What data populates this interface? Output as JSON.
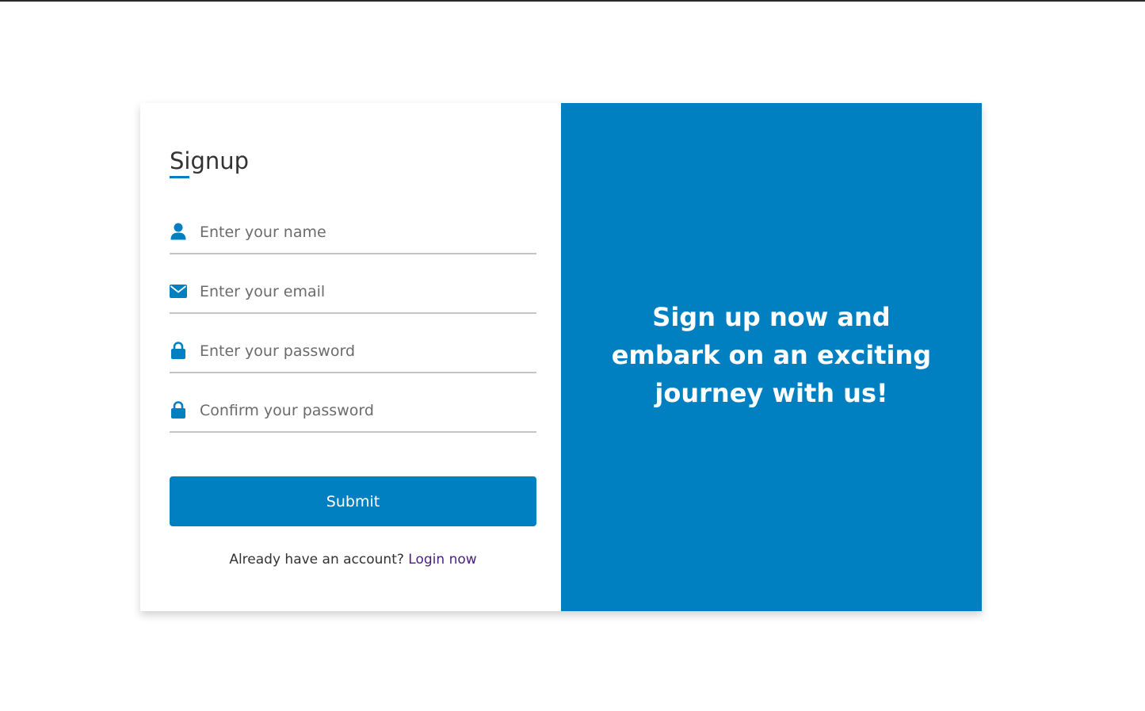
{
  "form": {
    "title": "Signup",
    "fields": [
      {
        "placeholder": "Enter your name",
        "icon": "user-icon",
        "type": "text"
      },
      {
        "placeholder": "Enter your email",
        "icon": "envelope-icon",
        "type": "email"
      },
      {
        "placeholder": "Enter your password",
        "icon": "lock-icon",
        "type": "password"
      },
      {
        "placeholder": "Confirm your password",
        "icon": "lock-icon",
        "type": "password"
      }
    ],
    "submit_label": "Submit",
    "login_prompt": "Already have an account?",
    "login_link": "Login now"
  },
  "promo": {
    "text": "Sign up now and embark on an exciting journey with us!"
  },
  "colors": {
    "accent": "#0080c0",
    "link": "#4b1f7a",
    "field_border": "#c4c4c4"
  }
}
